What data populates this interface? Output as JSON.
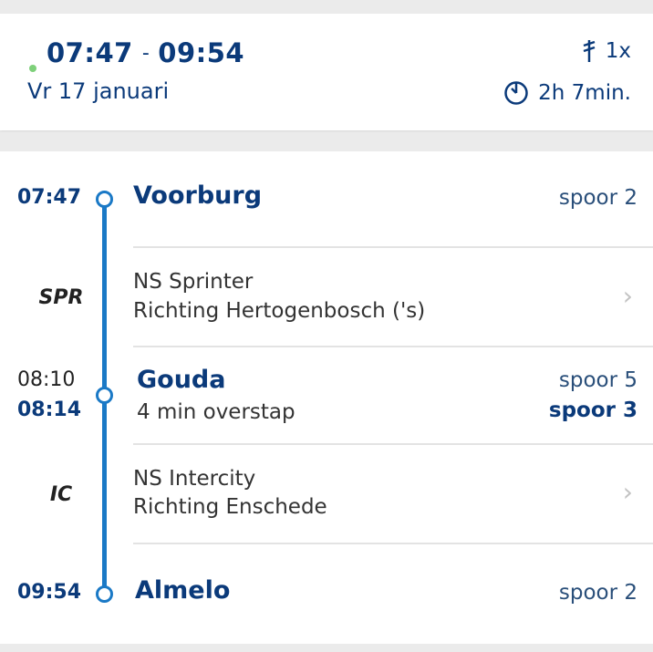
{
  "summary": {
    "departure": "07:47",
    "separator": "-",
    "arrival": "09:54",
    "date": "Vr 17 januari",
    "transfers": "1x",
    "transfers_icon": "transfer-walk-icon",
    "duration": "2h 7min.",
    "duration_icon": "timer-icon"
  },
  "journey": {
    "origin": {
      "time": "07:47",
      "station": "Voorburg",
      "platform": "spoor 2"
    },
    "leg1": {
      "mode": "SPR",
      "title": "NS Sprinter",
      "direction": "Richting Hertogenbosch ('s)"
    },
    "transfer": {
      "arr_time": "08:10",
      "dep_time": "08:14",
      "station": "Gouda",
      "note": "4 min overstap",
      "arr_platform": "spoor 5",
      "dep_platform": "spoor 3"
    },
    "leg2": {
      "mode": "IC",
      "title": "NS Intercity",
      "direction": "Richting Enschede"
    },
    "destination": {
      "time": "09:54",
      "station": "Almelo",
      "platform": "spoor 2"
    }
  },
  "colors": {
    "accent": "#1a79c6",
    "text_primary": "#0b3a7a",
    "realtime_dot": "#7ed07a"
  }
}
